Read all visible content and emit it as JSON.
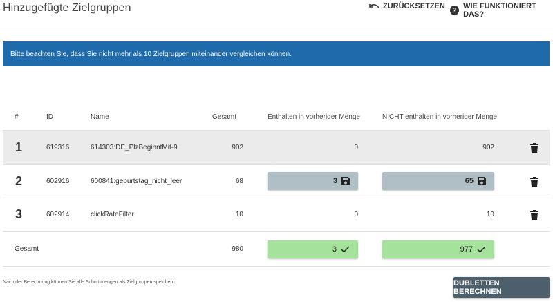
{
  "header": {
    "title": "Hinzugefügte Zielgruppen",
    "reset_label": "ZURÜCKSETZEN",
    "help_label": "WIE FUNKTIONIERT DAS?",
    "help_glyph": "?"
  },
  "banner": {
    "text": "Bitte beachten Sie, dass Sie nicht mehr als 10 Zielgruppen miteinander vergleichen können.",
    "color": "#1e6aab"
  },
  "table": {
    "columns": [
      "#",
      "ID",
      "Name",
      "Gesamt",
      "Enthalten in vorheriger Menge",
      "NICHT enthalten in vorheriger Menge"
    ],
    "rows": [
      {
        "num": "1",
        "id": "619316",
        "name": "614303:DE_PlzBeginntMit-9",
        "total": "902",
        "included": "0",
        "not_included": "902"
      },
      {
        "num": "2",
        "id": "602916",
        "name": "600841:geburtstag_nicht_leer",
        "total": "68",
        "included": "3",
        "not_included": "65"
      },
      {
        "num": "3",
        "id": "602914",
        "name": "clickRateFilter",
        "total": "10",
        "included": "0",
        "not_included": "10"
      }
    ],
    "totals": {
      "label": "Gesamt",
      "total": "980",
      "included": "3",
      "not_included": "977"
    }
  },
  "footer": {
    "note": "Nach der Berechnung können Sie alle Schnittmengen als Zielgruppen speichern.",
    "button_label": "DUBLETTEN BERECHNEN",
    "button_color": "#4c5f6b"
  },
  "icons": {
    "reset": "undo-icon",
    "help": "help-icon",
    "save": "floppy-disk-icon",
    "check": "check-icon",
    "delete": "trash-icon"
  }
}
